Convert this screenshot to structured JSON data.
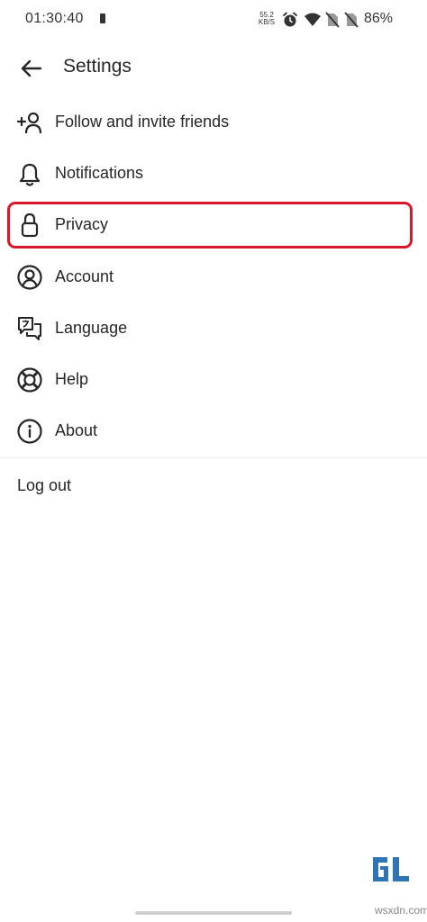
{
  "status_bar": {
    "time": "01:30:40",
    "speed_value": "55.2",
    "speed_unit": "KB/S",
    "battery_percent": "86%",
    "icons": [
      "battery-saver-icon",
      "alarm-icon",
      "wifi-icon",
      "no-sim-icon",
      "no-sim-icon",
      "battery-icon"
    ]
  },
  "header": {
    "title": "Settings",
    "back_icon": "arrow-left-icon"
  },
  "menu": {
    "items": [
      {
        "label": "Follow and invite friends",
        "icon": "add-person-icon"
      },
      {
        "label": "Notifications",
        "icon": "bell-icon"
      },
      {
        "label": "Privacy",
        "icon": "lock-icon",
        "highlighted": true
      },
      {
        "label": "Account",
        "icon": "account-icon"
      },
      {
        "label": "Language",
        "icon": "translate-icon"
      },
      {
        "label": "Help",
        "icon": "lifebuoy-icon"
      },
      {
        "label": "About",
        "icon": "info-icon"
      }
    ]
  },
  "logout": {
    "label": "Log out"
  },
  "watermark": {
    "site": "wsxdn.com"
  },
  "colors": {
    "highlight": "#d7182a",
    "text": "#262626",
    "divider": "#ececec"
  }
}
